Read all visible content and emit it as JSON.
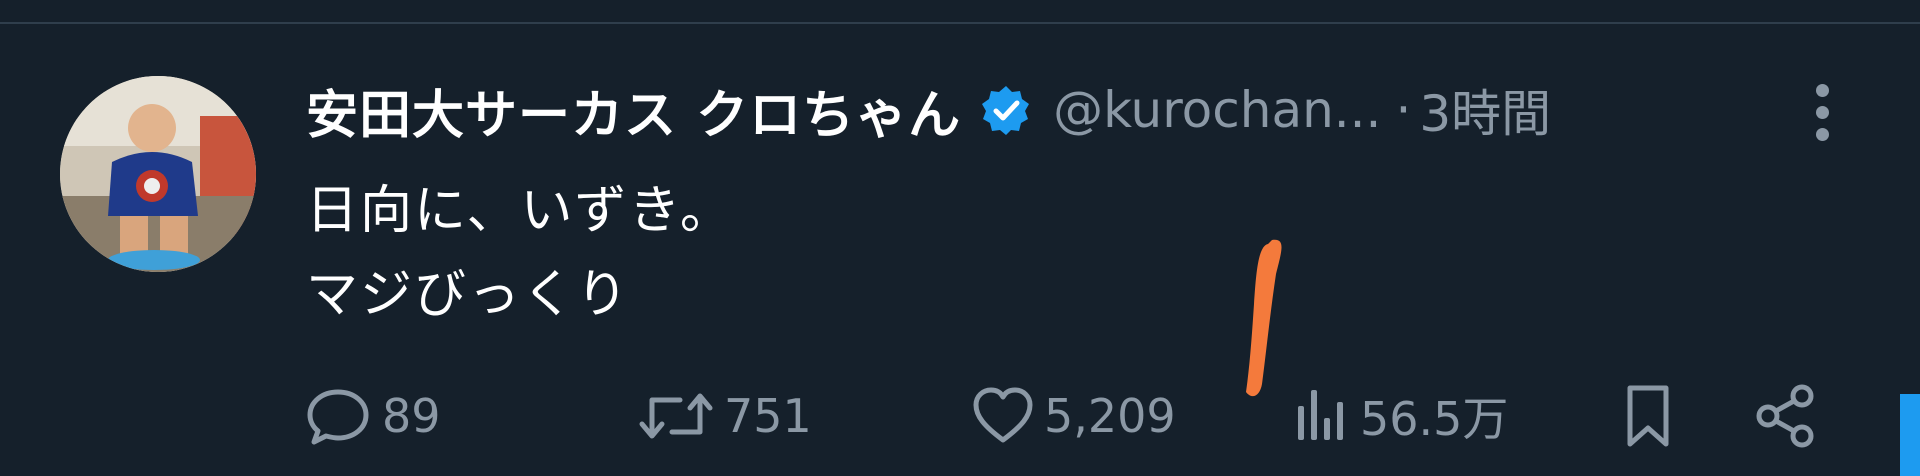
{
  "tweet": {
    "author": {
      "display_name": "安田大サーカス クロちゃん",
      "handle": "@kurochan...",
      "verified": true,
      "avatar": "avatar-photo"
    },
    "separator": "·",
    "timestamp": "3時間",
    "text_lines": [
      "日向に、いずき。",
      "マジびっくり"
    ]
  },
  "actions": {
    "reply": {
      "icon": "reply-bubble-icon",
      "count": "89"
    },
    "retweet": {
      "icon": "retweet-icon",
      "count": "751"
    },
    "like": {
      "icon": "heart-icon",
      "count": "5,209"
    },
    "views": {
      "icon": "views-chart-icon",
      "count": "56.5万"
    },
    "bookmark": {
      "icon": "bookmark-icon"
    },
    "share": {
      "icon": "share-icon"
    }
  },
  "more_menu": {
    "icon": "more-vertical-icon"
  },
  "colors": {
    "background": "#15202b",
    "primary_text": "#ffffff",
    "secondary_text": "#8b98a5",
    "verified_badge": "#1d9bf0",
    "annotation_mark": "#f47a3c"
  }
}
